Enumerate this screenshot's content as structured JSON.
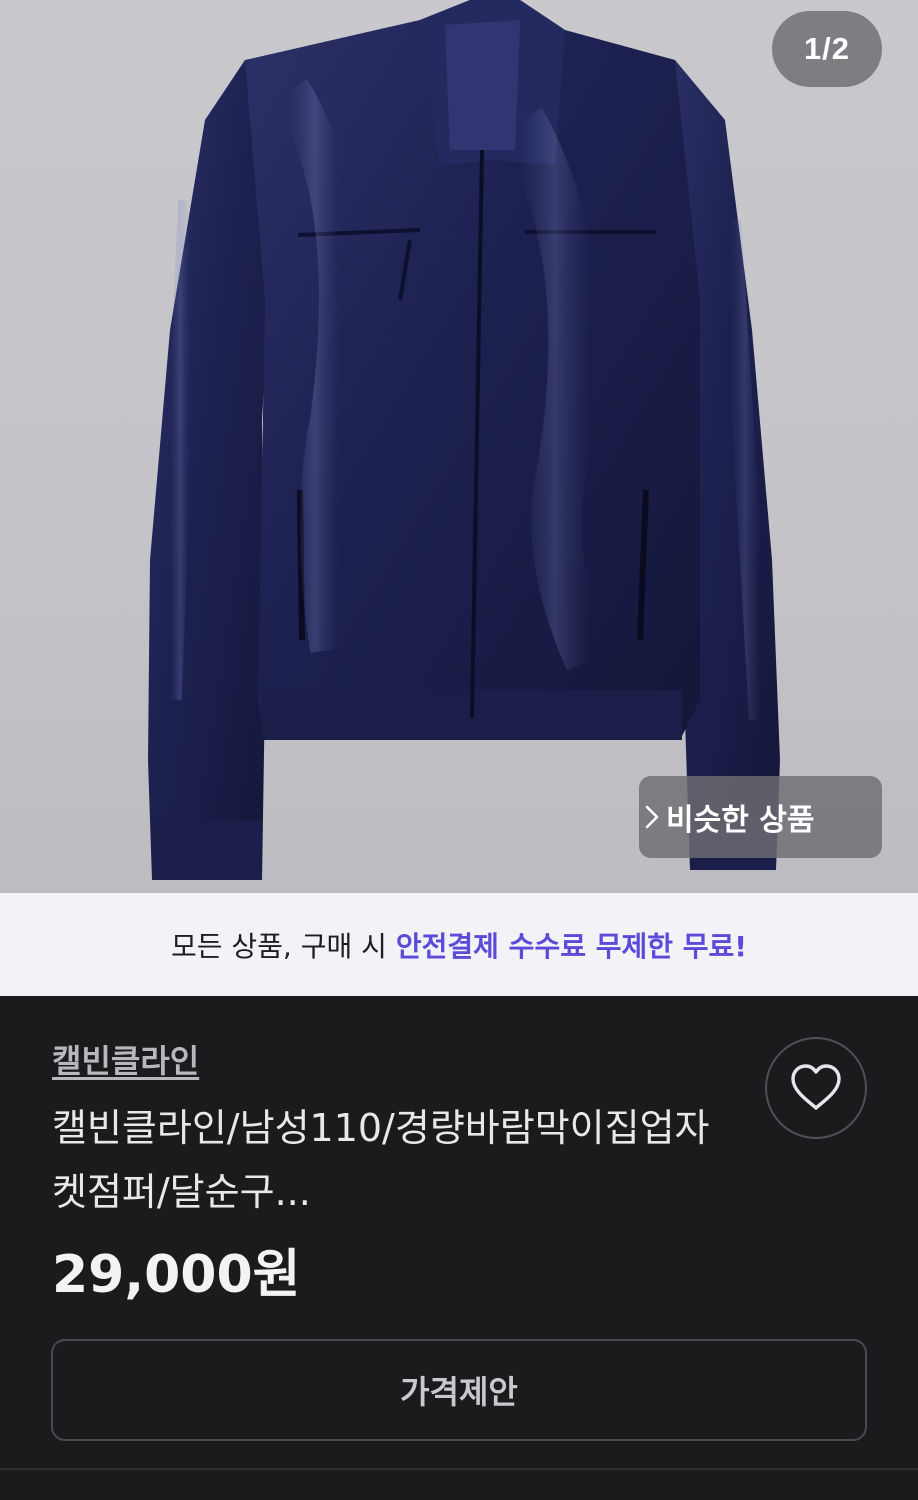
{
  "gallery": {
    "counter": "1/2",
    "similar_label": "비슷한 상품",
    "image_icon": "jacket-photo"
  },
  "banner": {
    "text": "모든 상품, 구매 시",
    "accent": "안전결제 수수료 무제한 무료!",
    "accent_color": "#5b4bd8"
  },
  "product": {
    "brand": "캘빈클라인",
    "title": "캘빈클라인/남성110/경량바람막이집업자켓점퍼/달순구...",
    "price": "29,000원"
  },
  "actions": {
    "like_icon": "heart-icon",
    "offer_label": "가격제안"
  }
}
